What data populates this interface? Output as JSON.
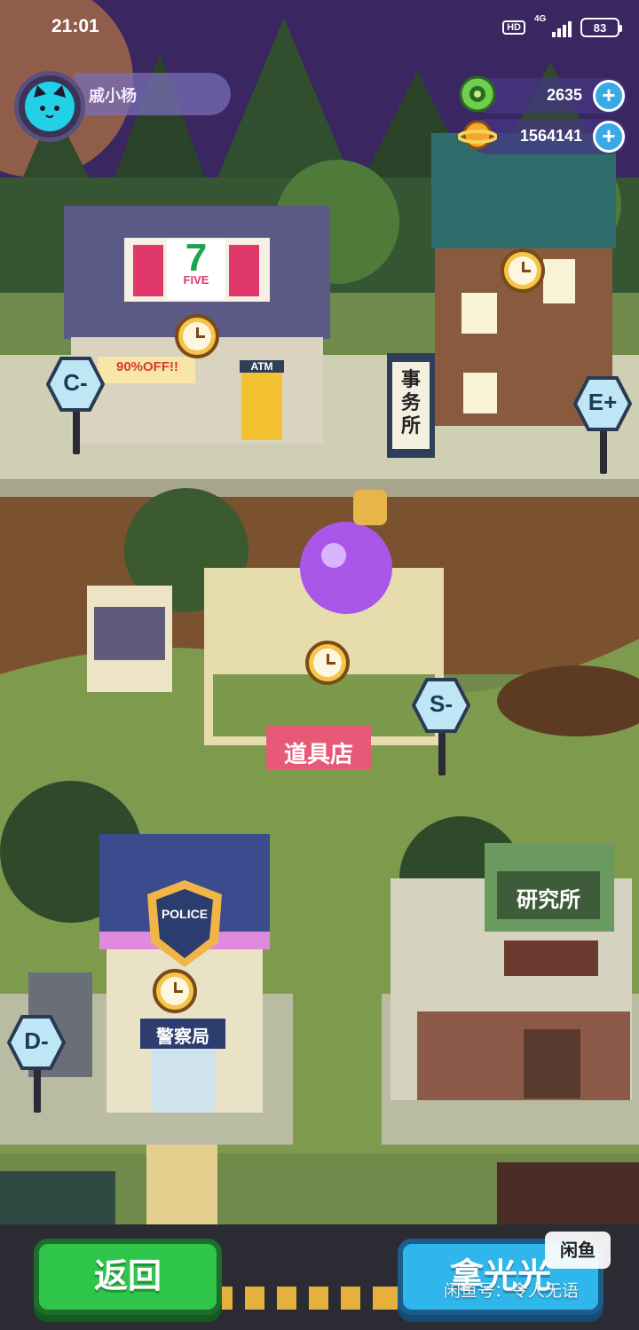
{
  "status_bar": {
    "time": "21:01",
    "hd": "HD",
    "network": "4G",
    "battery": "83"
  },
  "player": {
    "name": "戚小杨",
    "avatar_icon": "cat-face-icon"
  },
  "currencies": [
    {
      "icon": "green-gem-coin-icon",
      "value": "2635"
    },
    {
      "icon": "gold-planet-coin-icon",
      "value": "1564141"
    }
  ],
  "zones": [
    {
      "label": "C-"
    },
    {
      "label": "E+"
    },
    {
      "label": "S-"
    },
    {
      "label": "D-"
    }
  ],
  "buildings": {
    "store_logo": "7",
    "store_logo_sub": "FIVE",
    "store_sale": "90%OFF!!",
    "store_atm": "ATM",
    "office_sign": "事务所",
    "item_shop_sign": "道具店",
    "police_badge": "POLICE",
    "police_sign": "警察局",
    "lab_sign": "研究所"
  },
  "buttons": {
    "back": "返回",
    "collect": "拿光光"
  },
  "watermark": {
    "logo": "闲鱼",
    "text": "闲鱼号：令人无语"
  },
  "colors": {
    "sky": "#3a2660",
    "grass": "#7e9a4c",
    "road": "#c8c9ad",
    "back_button": "#2fc44a",
    "collect_button": "#2fb6ea",
    "hex_sign": "#bfe6f5"
  }
}
